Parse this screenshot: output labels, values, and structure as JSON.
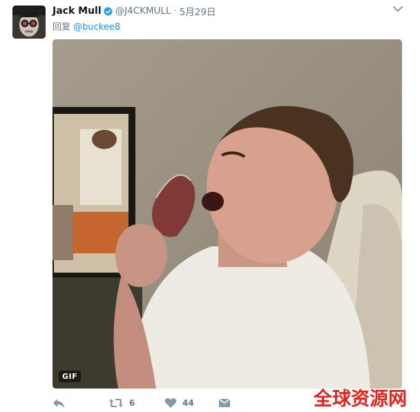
{
  "tweet": {
    "author_name": "Jack Mull",
    "handle": "@J4CKMULL",
    "separator": "·",
    "date": "5月29日",
    "reply_prefix": "回复",
    "reply_mention": "@buckee8"
  },
  "media": {
    "badge": "GIF"
  },
  "actions": {
    "reply_icon": "reply-icon",
    "retweet_icon": "retweet-icon",
    "retweet_count": "6",
    "like_icon": "heart-icon",
    "like_count": "44",
    "message_icon": "envelope-icon"
  },
  "watermark": {
    "text": "全球资源网"
  },
  "colors": {
    "name": "#14171a",
    "secondary": "#657786",
    "link": "#1b95e0",
    "verified": "#1da1f2",
    "watermark": "#e2231a"
  }
}
